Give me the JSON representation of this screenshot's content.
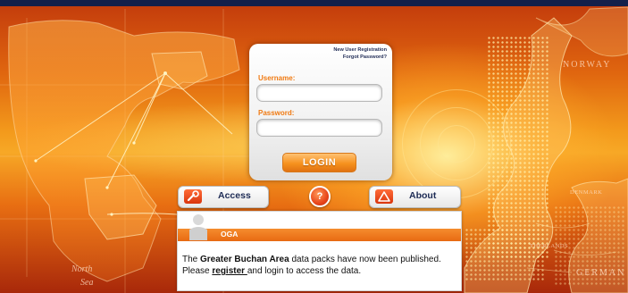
{
  "map": {
    "labels": {
      "norway": "NORWAY",
      "denmark": "DENMARK",
      "germany": "GERMAN",
      "netherlands": "THERLANDS",
      "north_sea": "North",
      "sea": "Sea"
    }
  },
  "login": {
    "new_user_link": "New User Registration",
    "forgot_link": "Forgot Password?",
    "username_label": "Username:",
    "password_label": "Password:",
    "username_value": "",
    "password_value": "",
    "login_button": "LOGIN"
  },
  "nav": {
    "access_label": "Access",
    "help_label": "?",
    "about_label": "About"
  },
  "news": {
    "title": "OGA",
    "line1_pre": "The ",
    "line1_bold": "Greater Buchan Area",
    "line1_post": " data packs have now been published.",
    "line2_pre": "Please ",
    "line2_link": "register ",
    "line2_post": "and login to access the data."
  },
  "colors": {
    "accent": "#f07a12",
    "brand_navy": "#1d2b55",
    "topbar": "#14204a"
  }
}
